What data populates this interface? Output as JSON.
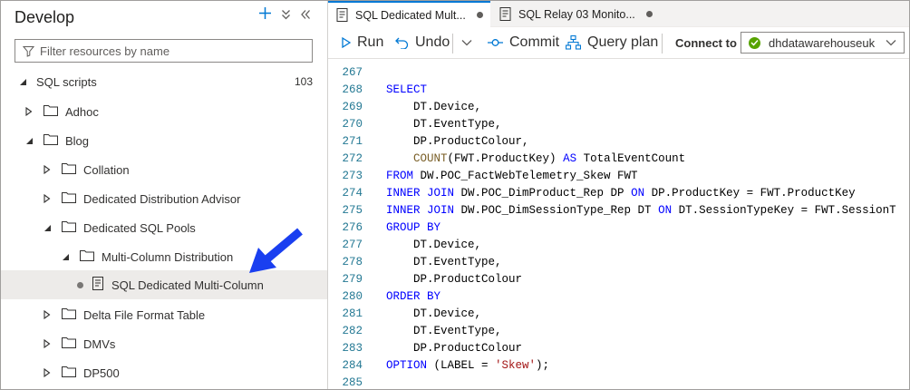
{
  "left_panel": {
    "title": "Develop",
    "add_icon": "plus-icon",
    "filter_placeholder": "Filter resources by name",
    "tree": [
      {
        "label": "SQL scripts",
        "count": "103",
        "level": 0,
        "expanded": true,
        "type": "section"
      },
      {
        "label": "Adhoc",
        "level": 1,
        "expanded": false,
        "type": "folder"
      },
      {
        "label": "Blog",
        "level": 1,
        "expanded": true,
        "type": "folder"
      },
      {
        "label": "Collation",
        "level": 2,
        "expanded": false,
        "type": "folder"
      },
      {
        "label": "Dedicated Distribution Advisor",
        "level": 2,
        "expanded": false,
        "type": "folder"
      },
      {
        "label": "Dedicated SQL Pools",
        "level": 2,
        "expanded": true,
        "type": "folder"
      },
      {
        "label": "Multi-Column Distribution",
        "level": 3,
        "expanded": true,
        "type": "folder"
      },
      {
        "label": "SQL Dedicated Multi-Column",
        "level": 4,
        "type": "script",
        "selected": true
      },
      {
        "label": "Delta File Format Table",
        "level": 2,
        "expanded": false,
        "type": "folder"
      },
      {
        "label": "DMVs",
        "level": 2,
        "expanded": false,
        "type": "folder"
      },
      {
        "label": "DP500",
        "level": 2,
        "expanded": false,
        "type": "folder"
      }
    ]
  },
  "tabs": [
    {
      "label": "SQL Dedicated Mult...",
      "active": true
    },
    {
      "label": "SQL Relay 03 Monito...",
      "active": false
    }
  ],
  "toolbar": {
    "run": "Run",
    "undo": "Undo",
    "commit": "Commit",
    "query_plan": "Query plan",
    "connect_to": "Connect to",
    "connection": "dhdatawarehouseuk"
  },
  "editor": {
    "lines": [
      {
        "n": "267",
        "code": ""
      },
      {
        "n": "268",
        "code": "SELECT"
      },
      {
        "n": "269",
        "code": "    DT.Device,"
      },
      {
        "n": "270",
        "code": "    DT.EventType,"
      },
      {
        "n": "271",
        "code": "    DP.ProductColour,"
      },
      {
        "n": "272",
        "code": "    COUNT(FWT.ProductKey) AS TotalEventCount"
      },
      {
        "n": "273",
        "code": "FROM DW.POC_FactWebTelemetry_Skew FWT"
      },
      {
        "n": "274",
        "code": "INNER JOIN DW.POC_DimProduct_Rep DP ON DP.ProductKey = FWT.ProductKey"
      },
      {
        "n": "275",
        "code": "INNER JOIN DW.POC_DimSessionType_Rep DT ON DT.SessionTypeKey = FWT.SessionT"
      },
      {
        "n": "276",
        "code": "GROUP BY"
      },
      {
        "n": "277",
        "code": "    DT.Device,"
      },
      {
        "n": "278",
        "code": "    DT.EventType,"
      },
      {
        "n": "279",
        "code": "    DP.ProductColour"
      },
      {
        "n": "280",
        "code": "ORDER BY"
      },
      {
        "n": "281",
        "code": "    DT.Device,"
      },
      {
        "n": "282",
        "code": "    DT.EventType,"
      },
      {
        "n": "283",
        "code": "    DP.ProductColour"
      },
      {
        "n": "284",
        "code": "OPTION (LABEL = 'Skew');"
      },
      {
        "n": "285",
        "code": ""
      }
    ]
  },
  "colors": {
    "accent": "#0078d4",
    "keyword": "#0000ff",
    "function": "#795e26",
    "string": "#a31515",
    "line_number": "#237893",
    "connected": "#57a300",
    "annotation_arrow": "#1a3ff0"
  }
}
